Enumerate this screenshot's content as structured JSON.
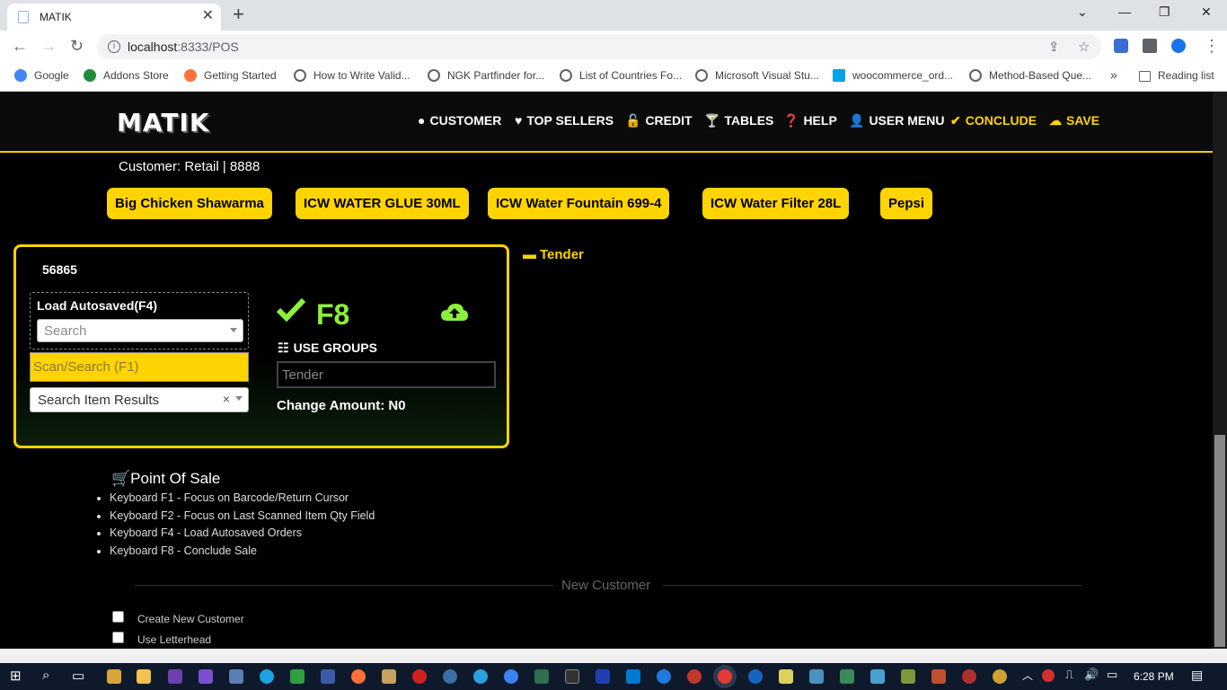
{
  "browser": {
    "tab_title": "MATIK",
    "url_host": "localhost",
    "url_path": ":8333/POS",
    "bookmarks": [
      "Google",
      "Addons Store",
      "Getting Started",
      "How to Write Valid...",
      "NGK Partfinder for...",
      "List of Countries Fo...",
      "Microsoft Visual Stu...",
      "woocommerce_ord...",
      "Method-Based Que..."
    ],
    "reading_list": "Reading list",
    "overflow": "»"
  },
  "app": {
    "logo": "MATIK",
    "nav": {
      "customer": "CUSTOMER",
      "top_sellers": "TOP SELLERS",
      "credit": "CREDIT",
      "tables": "TABLES",
      "help": "HELP",
      "user_menu": "USER MENU",
      "conclude": "CONCLUDE",
      "save": "SAVE"
    },
    "customer_line": "Customer: Retail | 8888",
    "quick_items": [
      "Big Chicken Shawarma",
      "ICW WATER GLUE 30ML",
      "ICW Water Fountain 699-4",
      "ICW Water Filter 28L",
      "Pepsi"
    ],
    "order_number": "56865",
    "load_autosaved_label": "Load Autosaved(F4)",
    "autosaved_placeholder": "Search",
    "scan_placeholder": "Scan/Search (F1)",
    "results_placeholder": "Search Item Results",
    "results_clear": "×",
    "f8_label": "F8",
    "use_groups": "USE GROUPS",
    "tender_placeholder": "Tender",
    "change_amount": "Change Amount: N0",
    "tender_heading": "Tender",
    "pos_title": "Point Of Sale",
    "shortcuts": [
      "Keyboard F1 - Focus on Barcode/Return Cursor",
      "Keyboard F2 - Focus on Last Scanned Item Qty Field",
      "Keyboard F4 - Load Autosaved Orders",
      "Keyboard F8 - Conclude Sale"
    ],
    "new_customer": "New Customer",
    "create_new_customer": "Create New Customer",
    "use_letterhead": "Use Letterhead"
  },
  "taskbar": {
    "clock": "6:28 PM"
  },
  "colors": {
    "accent": "#ffd400",
    "success": "#8cf03a",
    "background": "#000000"
  }
}
